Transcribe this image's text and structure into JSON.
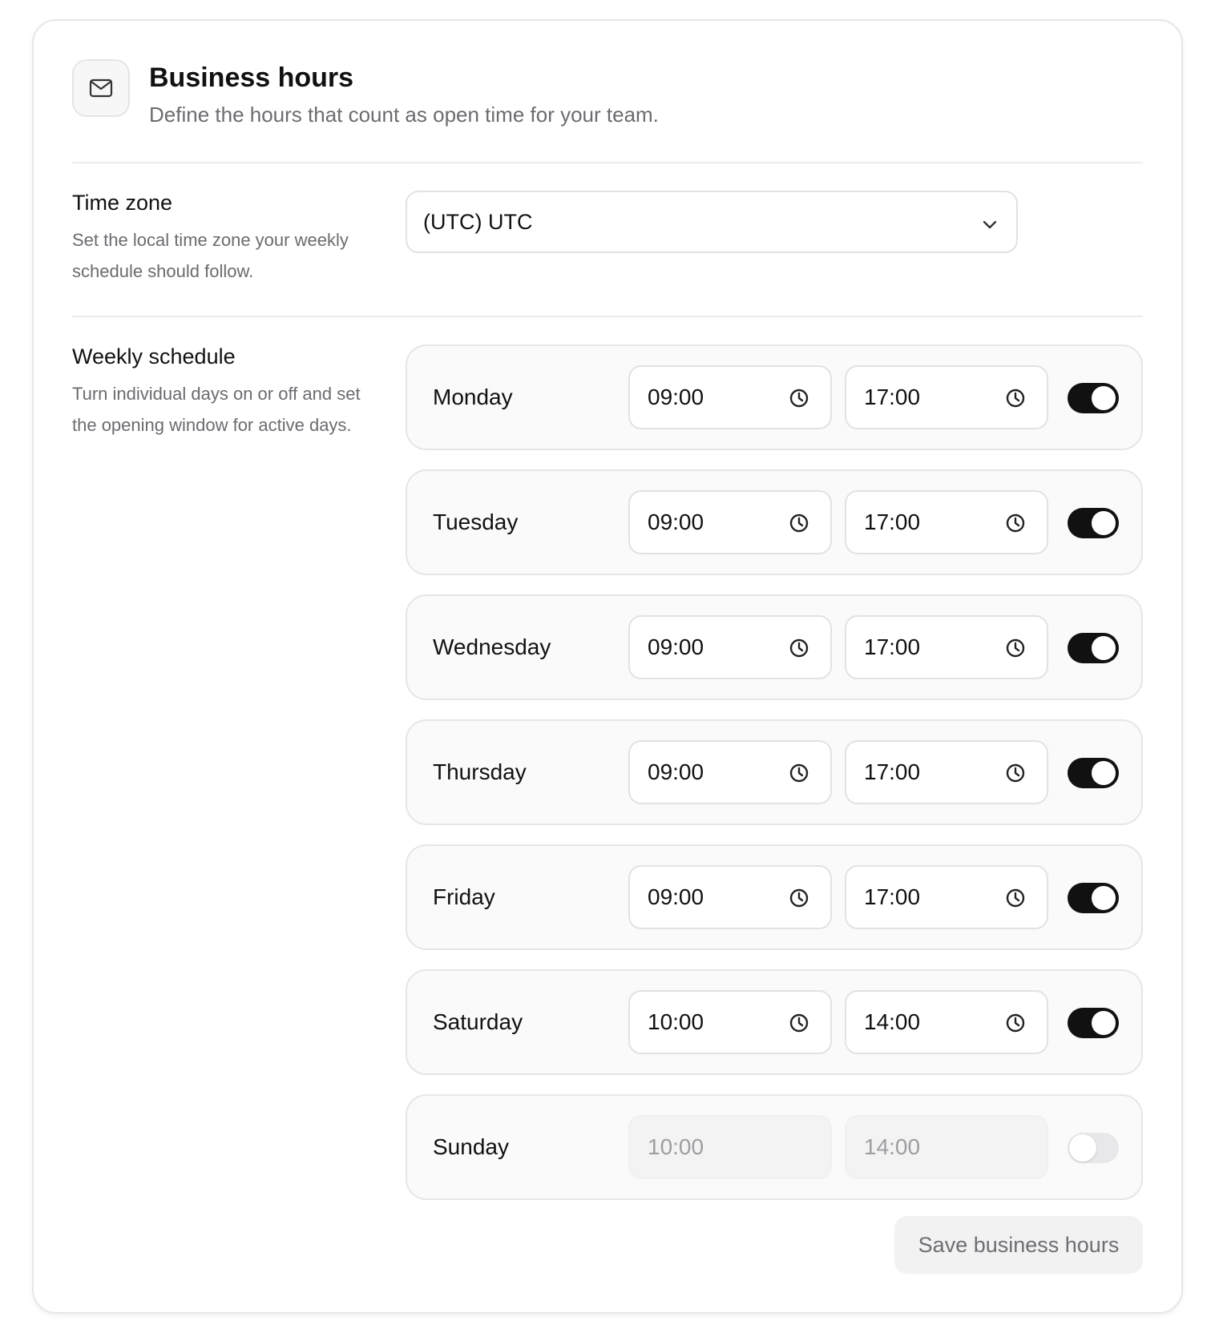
{
  "header": {
    "icon": "mail-icon",
    "title": "Business hours",
    "subtitle": "Define the hours that count as open time for your team."
  },
  "timezone": {
    "title": "Time zone",
    "description": "Set the local time zone your weekly schedule should follow.",
    "selected": "(UTC) UTC",
    "dropdown_icon": "chevron-down-icon"
  },
  "schedule": {
    "title": "Weekly schedule",
    "description": "Turn individual days on or off and set the opening window for active days.",
    "time_icon": "clock-icon",
    "days": [
      {
        "name": "Monday",
        "open": "09:00",
        "close": "17:00",
        "enabled": true
      },
      {
        "name": "Tuesday",
        "open": "09:00",
        "close": "17:00",
        "enabled": true
      },
      {
        "name": "Wednesday",
        "open": "09:00",
        "close": "17:00",
        "enabled": true
      },
      {
        "name": "Thursday",
        "open": "09:00",
        "close": "17:00",
        "enabled": true
      },
      {
        "name": "Friday",
        "open": "09:00",
        "close": "17:00",
        "enabled": true
      },
      {
        "name": "Saturday",
        "open": "10:00",
        "close": "14:00",
        "enabled": true
      },
      {
        "name": "Sunday",
        "open": "10:00",
        "close": "14:00",
        "enabled": false
      }
    ]
  },
  "save_label": "Save business hours",
  "colors": {
    "toggle_on": "#111111",
    "toggle_off": "#e8e8ea",
    "muted_text": "#6b6b70"
  }
}
